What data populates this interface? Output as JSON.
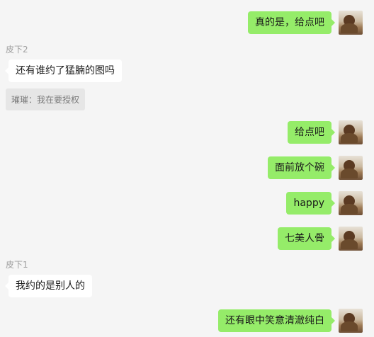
{
  "messages": [
    {
      "text": "真的是，给点吧"
    },
    {
      "sender": "皮下2",
      "text": "还有谁约了猛腩的图吗",
      "quote": "璀璀：我在要授权"
    },
    {
      "text": "给点吧"
    },
    {
      "text": "面前放个碗"
    },
    {
      "text": "happy"
    },
    {
      "text": "七美人骨"
    },
    {
      "sender": "皮下1",
      "text": "我约的是别人的"
    },
    {
      "text": "还有眼中笑意清澈纯白"
    }
  ],
  "avatar_icon": "user-avatar-photo"
}
